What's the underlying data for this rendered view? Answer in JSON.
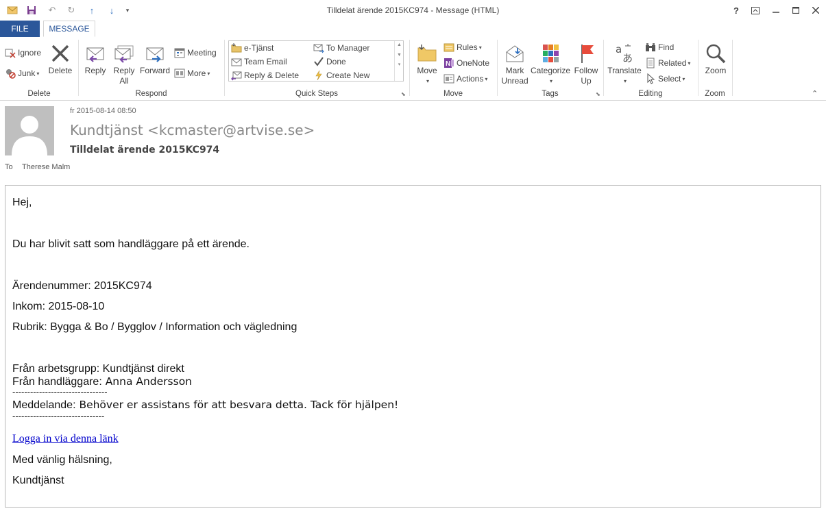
{
  "window": {
    "title": "Tilldelat ärende 2015KC974 - Message (HTML)"
  },
  "tabs": {
    "file": "FILE",
    "message": "MESSAGE"
  },
  "ribbon": {
    "delete_group": {
      "label": "Delete",
      "ignore": "Ignore",
      "junk": "Junk",
      "delete": "Delete"
    },
    "respond_group": {
      "label": "Respond",
      "reply": "Reply",
      "reply_all_1": "Reply",
      "reply_all_2": "All",
      "forward": "Forward",
      "meeting": "Meeting",
      "more": "More"
    },
    "quicksteps_group": {
      "label": "Quick Steps",
      "items": [
        "e-Tjänst",
        "To Manager",
        "Team Email",
        "Done",
        "Reply & Delete",
        "Create New"
      ]
    },
    "move_group": {
      "label": "Move",
      "move": "Move",
      "rules": "Rules",
      "onenote": "OneNote",
      "actions": "Actions"
    },
    "tags_group": {
      "label": "Tags",
      "mark_unread_1": "Mark",
      "mark_unread_2": "Unread",
      "categorize": "Categorize",
      "follow_up_1": "Follow",
      "follow_up_2": "Up"
    },
    "editing_group": {
      "label": "Editing",
      "translate": "Translate",
      "find": "Find",
      "related": "Related",
      "select": "Select"
    },
    "zoom_group": {
      "label": "Zoom",
      "zoom": "Zoom"
    }
  },
  "message": {
    "date": "fr 2015-08-14 08:50",
    "sender": "Kundtjänst <kcmaster@artvise.se>",
    "subject": "Tilldelat ärende 2015KC974",
    "to_label": "To",
    "to_name": "Therese Malm"
  },
  "body": {
    "greeting": "Hej,",
    "intro": "Du har blivit satt som handläggare på ett ärende.",
    "case_number": "Ärendenummer: 2015KC974",
    "inkom": "Inkom: 2015-08-10",
    "rubrik": "Rubrik: Bygga & Bo / Bygglov / Information och vägledning",
    "group_label": "Från arbetsgrupp: Kundtjänst direkt",
    "handler_label": "Från handläggare:",
    "handler_name": " Anna Andersson",
    "divider1": "--------------------------------",
    "message_label": "Meddelande:",
    "message_text": " Behöver er assistans för att besvara detta. Tack för hjälpen!",
    "divider2": "-------------------------------",
    "link": "Logga in via denna länk",
    "closing": "Med vänlig hälsning,",
    "signature": "Kundtjänst"
  },
  "colors": {
    "accent": "#2b579a",
    "link": "#0000cc"
  }
}
